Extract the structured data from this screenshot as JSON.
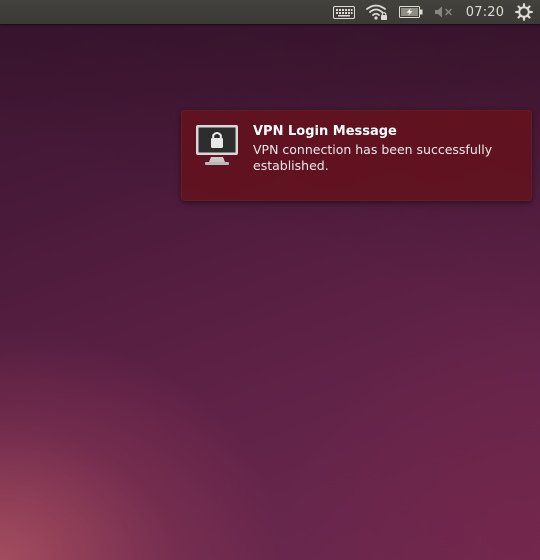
{
  "panel": {
    "indicators": {
      "keyboard": "keyboard-icon",
      "network": "wifi-locked-icon",
      "battery": "battery-charging-icon",
      "sound": "sound-muted-icon",
      "session": "gear-icon"
    },
    "clock": "07:20"
  },
  "notification": {
    "icon": "monitor-lock-icon",
    "title": "VPN Login Message",
    "body": "VPN connection has been successfully established."
  },
  "colors": {
    "panel_bg": "#3c3b37",
    "panel_text": "#dfdbd2",
    "notification_bg": "#62121e",
    "desktop_dark": "#3a1530",
    "desktop_warm": "#b05462"
  }
}
